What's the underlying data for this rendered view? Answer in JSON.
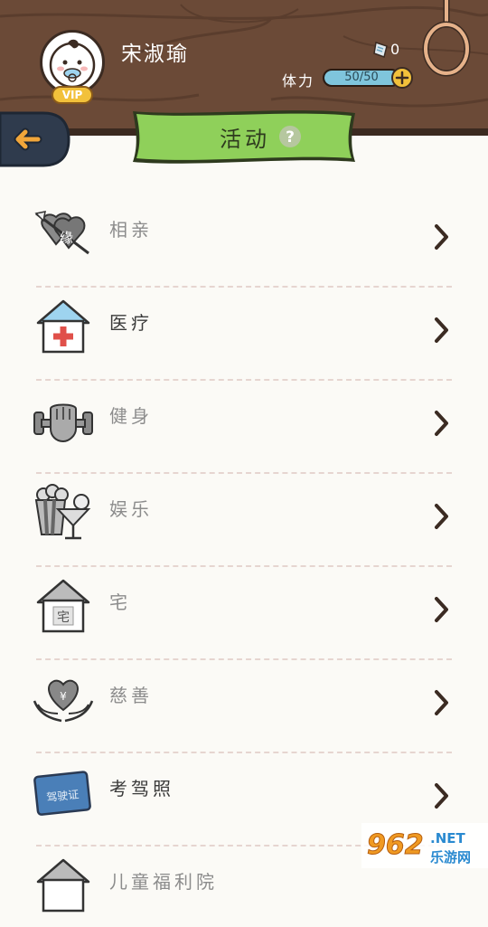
{
  "player": {
    "name": "宋淑瑜",
    "vip_badge": "VIP",
    "ticket_count": "0",
    "stamina_label": "体力",
    "stamina_text": "50/50",
    "stamina_fraction": 1.0
  },
  "page": {
    "title": "活动",
    "help_glyph": "?"
  },
  "activities": [
    {
      "label": "相亲",
      "icon": "love-arrow-heart-icon",
      "enabled": false
    },
    {
      "label": "医疗",
      "icon": "hospital-icon",
      "enabled": true
    },
    {
      "label": "健身",
      "icon": "fist-dumbbell-icon",
      "enabled": false
    },
    {
      "label": "娱乐",
      "icon": "popcorn-cocktail-icon",
      "enabled": false
    },
    {
      "label": "宅",
      "icon": "house-icon",
      "enabled": false
    },
    {
      "label": "慈善",
      "icon": "charity-heart-hands-icon",
      "enabled": false
    },
    {
      "label": "考驾照",
      "icon": "driving-license-icon",
      "enabled": true
    },
    {
      "label": "儿童福利院",
      "icon": "orphanage-icon",
      "enabled": false
    }
  ],
  "icon_text": {
    "love": "缘",
    "house": "宅",
    "license": "驾驶证",
    "charity": "¥"
  },
  "watermark": {
    "brand": "962",
    "suffix": ".NET",
    "site": "乐游网"
  },
  "colors": {
    "wood": "#6a4a38",
    "banner_green": "#8fd05a",
    "stamina_blue": "#7fc5dc",
    "vip_gold": "#f2c13b",
    "back_orange": "#f1a63a"
  }
}
